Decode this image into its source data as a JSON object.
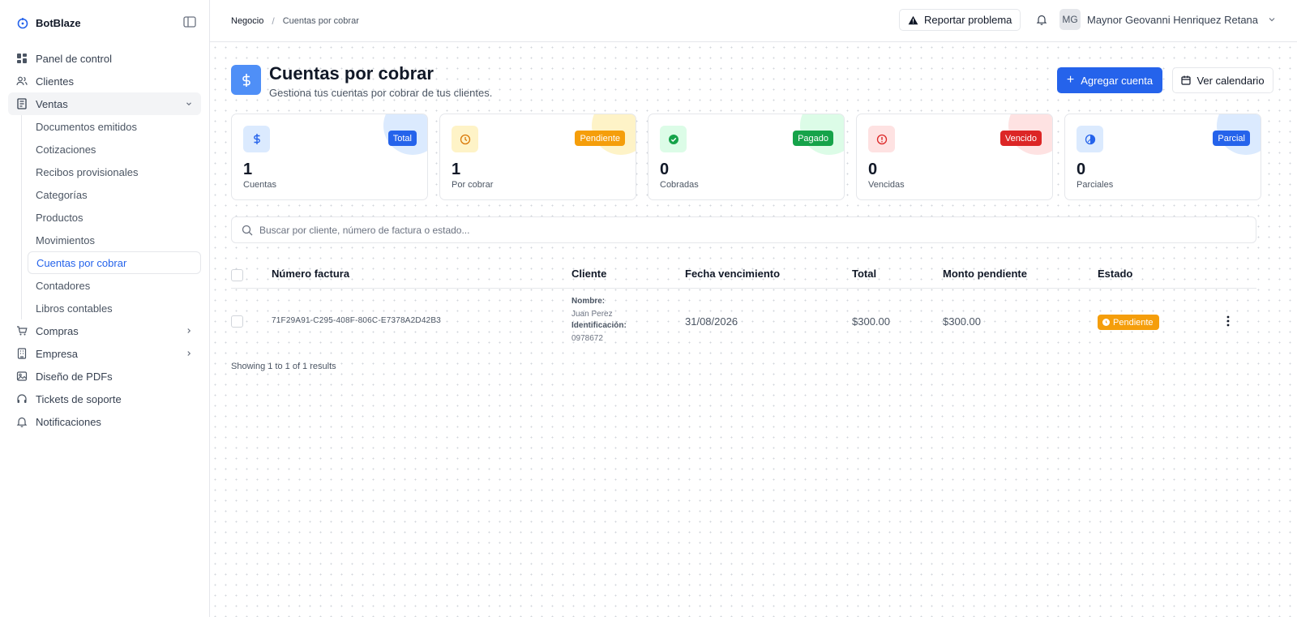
{
  "brand": {
    "name": "BotBlaze"
  },
  "sidebar": {
    "items": [
      {
        "label": "Panel de control",
        "icon": "dashboard-icon"
      },
      {
        "label": "Clientes",
        "icon": "users-icon"
      },
      {
        "label": "Ventas",
        "icon": "receipt-icon",
        "expanded": true
      },
      {
        "label": "Compras",
        "icon": "cart-icon"
      },
      {
        "label": "Empresa",
        "icon": "building-icon"
      },
      {
        "label": "Diseño de PDFs",
        "icon": "pdf-icon"
      },
      {
        "label": "Tickets de soporte",
        "icon": "headset-icon"
      },
      {
        "label": "Notificaciones",
        "icon": "bell-icon"
      }
    ],
    "ventas_sub": [
      "Documentos emitidos",
      "Cotizaciones",
      "Recibos provisionales",
      "Categorías",
      "Productos",
      "Movimientos",
      "Cuentas por cobrar",
      "Contadores",
      "Libros contables"
    ]
  },
  "topbar": {
    "breadcrumb": [
      "Negocio",
      "Cuentas por cobrar"
    ],
    "report_label": "Reportar problema",
    "user_initials": "MG",
    "user_name": "Maynor Geovanni Henriquez Retana"
  },
  "page": {
    "title": "Cuentas por cobrar",
    "subtitle": "Gestiona tus cuentas por cobrar de tus clientes.",
    "add_label": "Agregar cuenta",
    "calendar_label": "Ver calendario"
  },
  "cards": [
    {
      "badge": "Total",
      "value": "1",
      "label": "Cuentas",
      "color": "#2563eb",
      "icon": "dollar-icon"
    },
    {
      "badge": "Pendiente",
      "value": "1",
      "label": "Por cobrar",
      "color": "#f59e0b",
      "icon": "clock-icon"
    },
    {
      "badge": "Pagado",
      "value": "0",
      "label": "Cobradas",
      "color": "#16a34a",
      "icon": "check-circle-icon"
    },
    {
      "badge": "Vencido",
      "value": "0",
      "label": "Vencidas",
      "color": "#dc2626",
      "icon": "alert-circle-icon"
    },
    {
      "badge": "Parcial",
      "value": "0",
      "label": "Parciales",
      "color": "#2563eb",
      "icon": "partial-circle-icon"
    }
  ],
  "search": {
    "placeholder": "Buscar por cliente, número de factura o estado..."
  },
  "table": {
    "columns": [
      "Número factura",
      "Cliente",
      "Fecha vencimiento",
      "Total",
      "Monto pendiente",
      "Estado"
    ],
    "rows": [
      {
        "invoice": "71F29A91-C295-408F-806C-E7378A2D42B3",
        "name_label": "Nombre:",
        "name": "Juan Perez",
        "id_label": "Identificación:",
        "id": "0978672",
        "due": "31/08/2026",
        "total": "$300.00",
        "pending": "$300.00",
        "status": "Pendiente"
      }
    ],
    "showing": "Showing 1 to 1 of 1 results"
  }
}
